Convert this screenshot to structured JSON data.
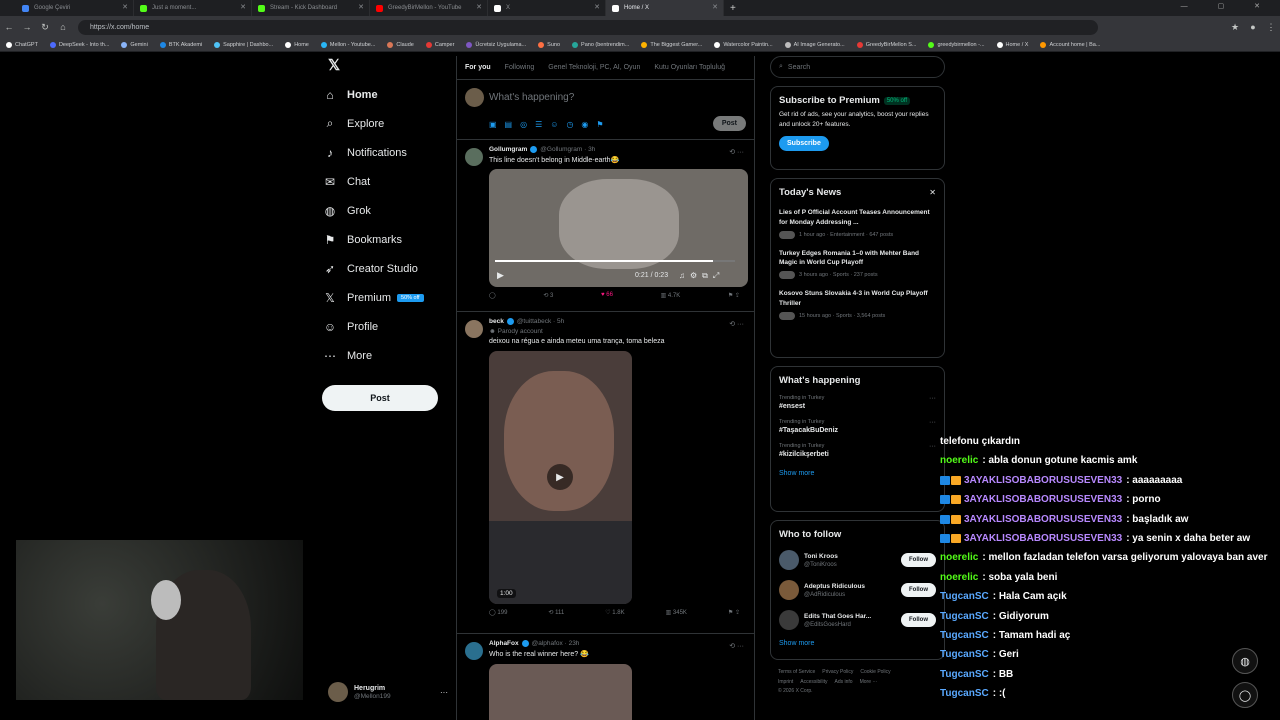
{
  "browser": {
    "tabs": [
      {
        "title": "Google Çeviri",
        "color": "#4285f4",
        "active": false
      },
      {
        "title": "Just a moment...",
        "color": "#53fc18",
        "active": false
      },
      {
        "title": "Stream - Kick Dashboard",
        "color": "#53fc18",
        "active": false
      },
      {
        "title": "GreedyBirMellon - YouTube",
        "color": "#ff0000",
        "active": false
      },
      {
        "title": "X",
        "color": "#ffffff",
        "active": false
      },
      {
        "title": "Home / X",
        "color": "#ffffff",
        "active": true
      }
    ],
    "url": "https://x.com/home",
    "bookmarks": [
      {
        "label": "ChatGPT",
        "color": "#ffffff"
      },
      {
        "label": "DeepSeek - Into th...",
        "color": "#4d6bfe"
      },
      {
        "label": "Gemini",
        "color": "#8ab4f8"
      },
      {
        "label": "BTK Akademi",
        "color": "#1e88e5"
      },
      {
        "label": "Sapphire | Dashbo...",
        "color": "#4fc3f7"
      },
      {
        "label": "Home",
        "color": "#ffffff"
      },
      {
        "label": "Mellon - Youtube...",
        "color": "#29b6f6"
      },
      {
        "label": "Claude",
        "color": "#d97757"
      },
      {
        "label": "Camper",
        "color": "#e53935"
      },
      {
        "label": "Ücretsiz Uygulama...",
        "color": "#7e57c2"
      },
      {
        "label": "Suno",
        "color": "#ff7043"
      },
      {
        "label": "Pano (bentrendim...",
        "color": "#26a69a"
      },
      {
        "label": "The Biggest Gamer...",
        "color": "#ffb300"
      },
      {
        "label": "Watercolor Paintin...",
        "color": "#ffffff"
      },
      {
        "label": "AI Image Generato...",
        "color": "#bdbdbd"
      },
      {
        "label": "GreedyBirMellon S...",
        "color": "#e53935"
      },
      {
        "label": "greedybirmellon -...",
        "color": "#53fc18"
      },
      {
        "label": "Home / X",
        "color": "#ffffff"
      },
      {
        "label": "Account home | Ba...",
        "color": "#ff9800"
      }
    ]
  },
  "nav": {
    "items": [
      {
        "label": "Home",
        "icon": "home-icon",
        "glyph": "⌂"
      },
      {
        "label": "Explore",
        "icon": "search-icon",
        "glyph": "⌕"
      },
      {
        "label": "Notifications",
        "icon": "bell-icon",
        "glyph": "♪"
      },
      {
        "label": "Chat",
        "icon": "mail-icon",
        "glyph": "✉"
      },
      {
        "label": "Grok",
        "icon": "grok-icon",
        "glyph": "◍"
      },
      {
        "label": "Bookmarks",
        "icon": "bookmark-icon",
        "glyph": "⚑"
      },
      {
        "label": "Creator Studio",
        "icon": "rocket-icon",
        "glyph": "➶"
      },
      {
        "label": "Premium",
        "icon": "x-logo-icon",
        "glyph": "𝕏"
      },
      {
        "label": "Profile",
        "icon": "person-icon",
        "glyph": "☺"
      },
      {
        "label": "More",
        "icon": "more-icon",
        "glyph": "⋯"
      }
    ],
    "premium_badge": "50% off",
    "post_label": "Post",
    "account": {
      "name": "Herugrim",
      "handle": "@Mellon199"
    }
  },
  "feed": {
    "tabs": [
      "For you",
      "Following",
      "Genel Teknoloji, PC, AI, Oyun",
      "Kutu Oyunları Topluluğ"
    ],
    "compose_placeholder": "What's happening?",
    "compose_post": "Post",
    "tweets": [
      {
        "name": "Gollumgram",
        "handle": "@Gollumgram · 3h",
        "text": "This line doesn't belong in Middle-earth😂",
        "video_time": "0:21 / 0:23",
        "video_progress": 0.91,
        "stats": {
          "replies": "",
          "reposts": "3",
          "likes": "66",
          "views": "4.7K"
        }
      },
      {
        "name": "beck",
        "handle": "@tuittabeck · 5h",
        "sub": "Parody account",
        "text": "deixou na régua e ainda meteu uma trança, toma beleza",
        "video_time": "1:00",
        "stats": {
          "replies": "199",
          "reposts": "111",
          "likes": "1.8K",
          "views": "345K"
        }
      },
      {
        "name": "AlphaFox",
        "handle": "@alphafox · 23h",
        "text": "Who is the real winner here? 😂"
      }
    ]
  },
  "right": {
    "search_placeholder": "Search",
    "premium": {
      "title": "Subscribe to Premium",
      "badge": "50% off",
      "desc": "Get rid of ads, see your analytics, boost your replies and unlock 20+ features.",
      "button": "Subscribe"
    },
    "news": {
      "title": "Today's News",
      "items": [
        {
          "title": "Lies of P Official Account Teases Announcement for Monday Addressing ...",
          "meta": "1 hour ago · Entertainment · 647 posts"
        },
        {
          "title": "Turkey Edges Romania 1–0 with Mehter Band Magic in World Cup Playoff",
          "meta": "3 hours ago · Sports · 237 posts"
        },
        {
          "title": "Kosovo Stuns Slovakia 4-3 in World Cup Playoff Thriller",
          "meta": "15 hours ago · Sports · 3,564 posts"
        }
      ]
    },
    "happening": {
      "title": "What's happening",
      "trends": [
        {
          "sub": "Trending in Turkey",
          "tag": "#ensest"
        },
        {
          "sub": "Trending in Turkey",
          "tag": "#TaşacakBuDeniz"
        },
        {
          "sub": "Trending in Turkey",
          "tag": "#kizilcikşerbeti"
        }
      ],
      "show_more": "Show more"
    },
    "follow": {
      "title": "Who to follow",
      "people": [
        {
          "name": "Toni Kroos",
          "handle": "@ToniKroos"
        },
        {
          "name": "Adeptus Ridiculous",
          "handle": "@AdRidiculous"
        },
        {
          "name": "Edits That Goes Har...",
          "handle": "@EditsGoesHard"
        }
      ],
      "button": "Follow",
      "show_more": "Show more"
    },
    "footer": [
      "Terms of Service",
      "Privacy Policy",
      "Cookie Policy",
      "Imprint",
      "Accessibility",
      "Ads info",
      "More ···",
      "© 2026 X Corp."
    ]
  },
  "chat": {
    "messages": [
      {
        "user": "",
        "text": "telefonu çıkardın",
        "color": "#ffffff",
        "badges": false
      },
      {
        "user": "noerelic",
        "text": ": abla donun gotune kacmis amk",
        "color": "#53fc18",
        "badges": false
      },
      {
        "user": "3AYAKLISOBABORUSUSEVEN33",
        "text": ": aaaaaaaaa",
        "color": "#b889ff",
        "badges": true
      },
      {
        "user": "3AYAKLISOBABORUSUSEVEN33",
        "text": ": porno",
        "color": "#b889ff",
        "badges": true
      },
      {
        "user": "3AYAKLISOBABORUSUSEVEN33",
        "text": ": başladık aw",
        "color": "#b889ff",
        "badges": true
      },
      {
        "user": "3AYAKLISOBABORUSUSEVEN33",
        "text": ": ya senin x daha beter aw",
        "color": "#b889ff",
        "badges": true
      },
      {
        "user": "noerelic",
        "text": ": mellon fazladan telefon varsa geliyorum yalovaya ban aver",
        "color": "#53fc18",
        "badges": false
      },
      {
        "user": "noerelic",
        "text": ": soba yala beni",
        "color": "#53fc18",
        "badges": false
      },
      {
        "user": "TugcanSC",
        "text": ": Hala Cam açık",
        "color": "#5aa9ff",
        "badges": false
      },
      {
        "user": "TugcanSC",
        "text": ": Gidiyorum",
        "color": "#5aa9ff",
        "badges": false
      },
      {
        "user": "TugcanSC",
        "text": ": Tamam hadi aç",
        "color": "#5aa9ff",
        "badges": false
      },
      {
        "user": "TugcanSC",
        "text": ": Geri",
        "color": "#5aa9ff",
        "badges": false
      },
      {
        "user": "TugcanSC",
        "text": ": BB",
        "color": "#5aa9ff",
        "badges": false
      },
      {
        "user": "TugcanSC",
        "text": ": :(",
        "color": "#5aa9ff",
        "badges": false
      }
    ]
  },
  "colors": {
    "accent": "#1d9bf0",
    "like": "#f91880",
    "kick_green": "#53fc18"
  }
}
